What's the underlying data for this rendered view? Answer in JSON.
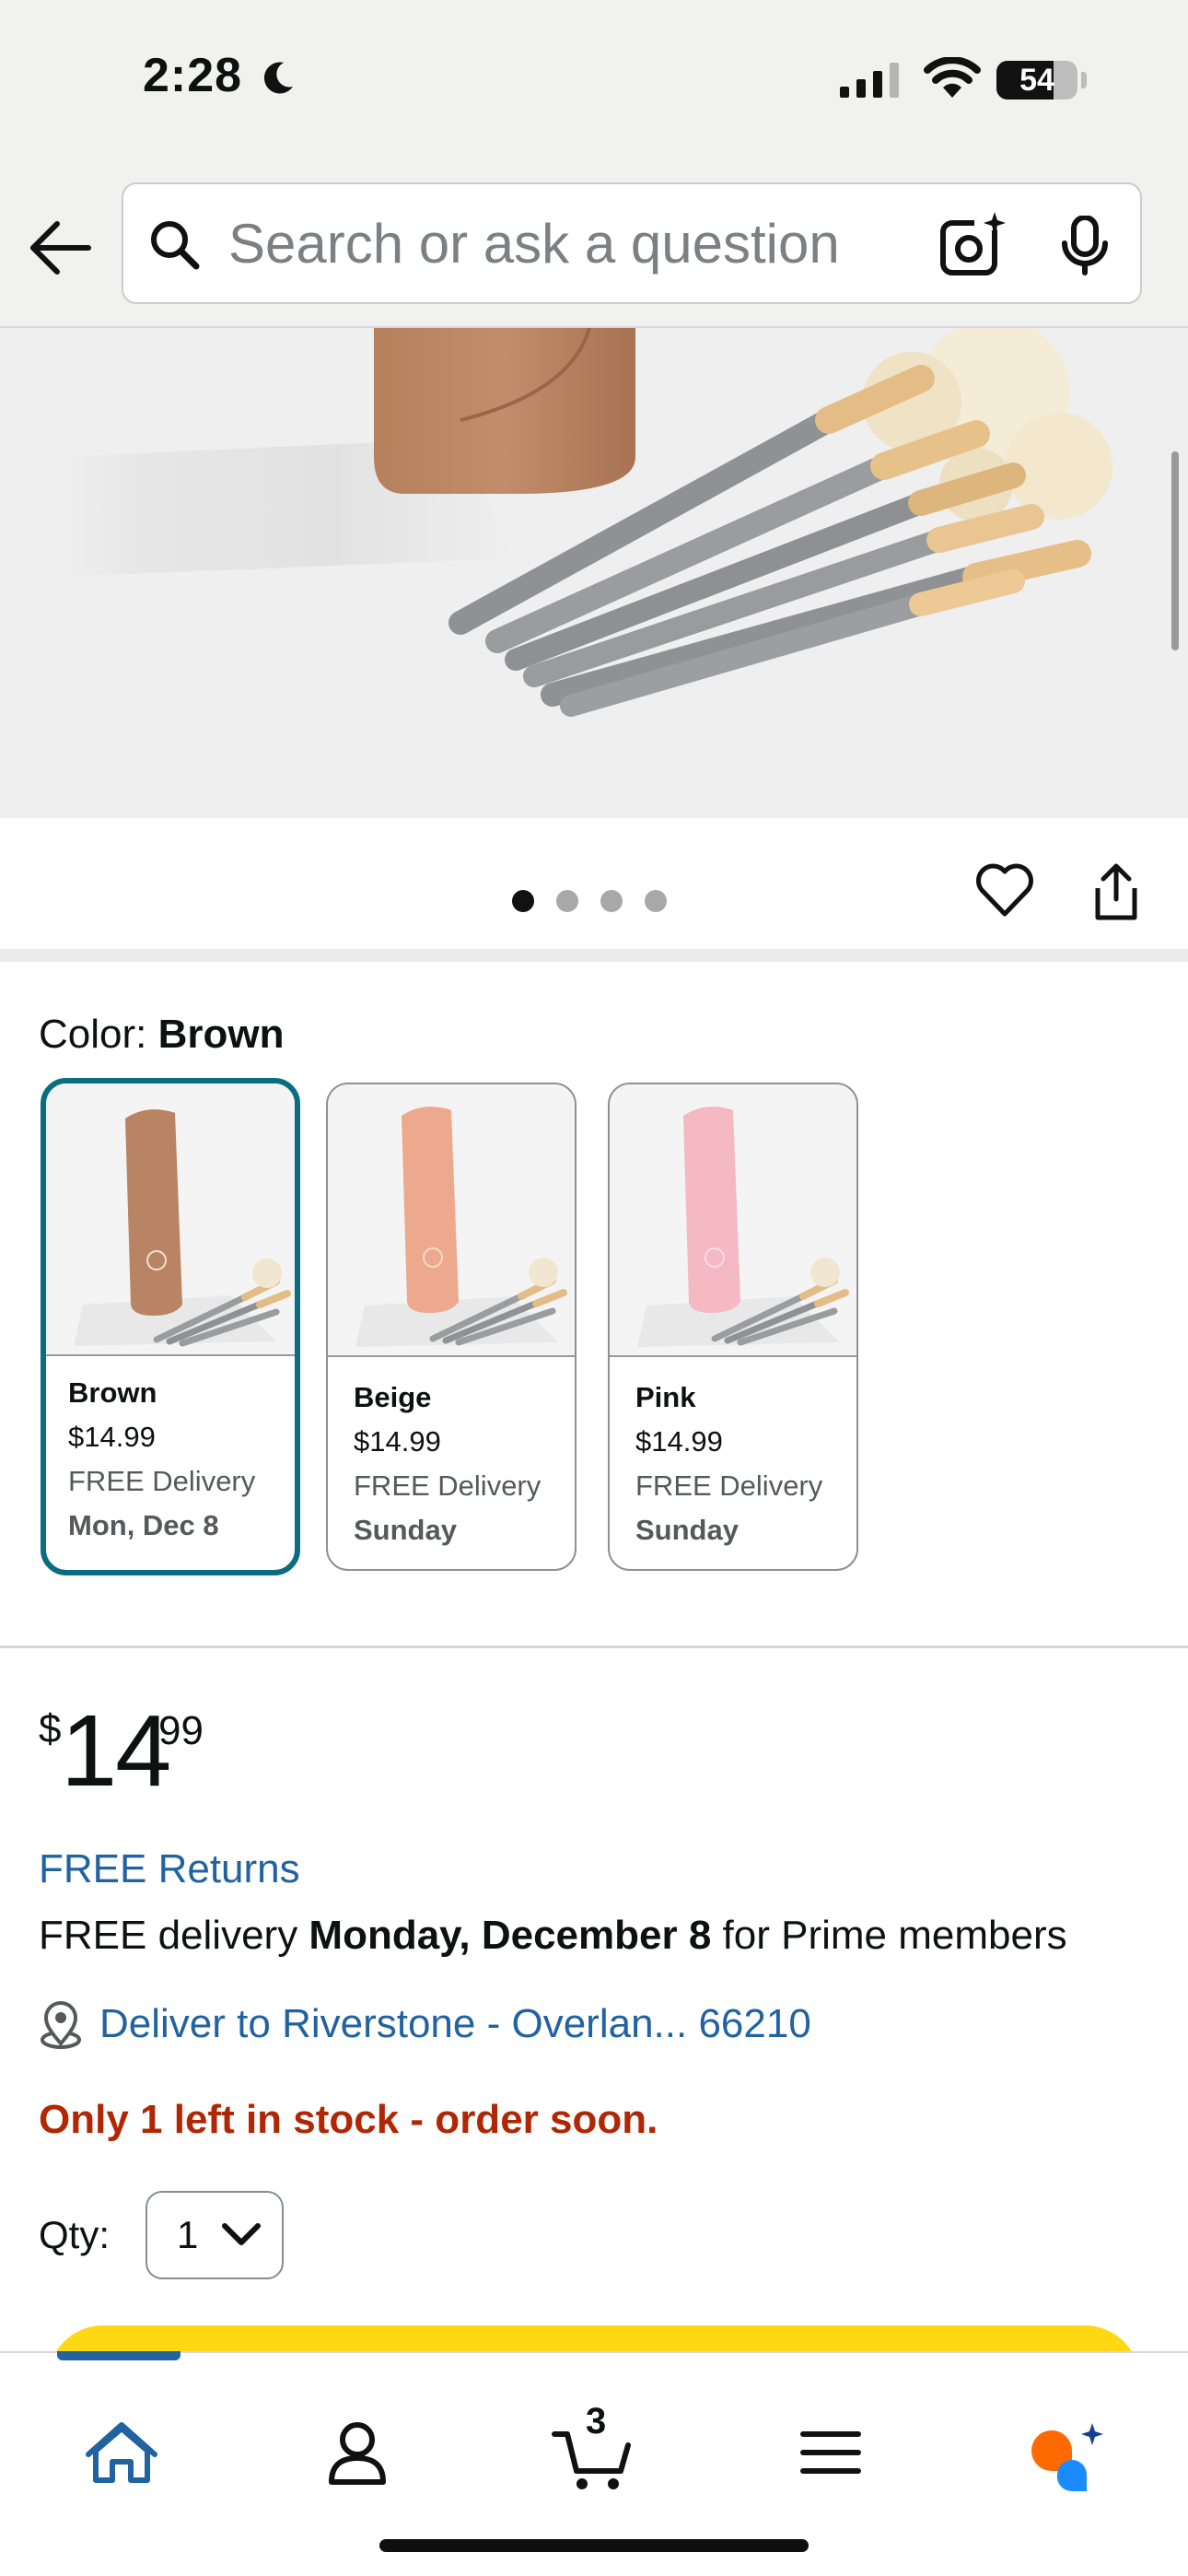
{
  "status_bar": {
    "time": "2:28",
    "battery": "54",
    "battery_level": 0.54
  },
  "search": {
    "placeholder": "Search or ask a question"
  },
  "gallery": {
    "image_count": 4,
    "active_index": 0
  },
  "color": {
    "label": "Color:",
    "selected": "Brown",
    "options": [
      {
        "name": "Brown",
        "price": "$14.99",
        "delivery": "FREE Delivery",
        "date": "Mon, Dec 8",
        "case_color": "#b98463"
      },
      {
        "name": "Beige",
        "price": "$14.99",
        "delivery": "FREE Delivery",
        "date": "Sunday",
        "case_color": "#eda98e"
      },
      {
        "name": "Pink",
        "price": "$14.99",
        "delivery": "FREE Delivery",
        "date": "Sunday",
        "case_color": "#f4b9c3"
      }
    ]
  },
  "price": {
    "currency": "$",
    "whole": "14",
    "fraction": "99"
  },
  "returns": "FREE Returns",
  "delivery": {
    "prefix": "FREE delivery",
    "date": "Monday, December 8",
    "suffix": "for Prime members"
  },
  "location": "Deliver to Riverstone - Overlan... 66210",
  "stock": "Only 1 left in stock - order soon.",
  "quantity": {
    "label": "Qty:",
    "value": "1"
  },
  "tabbar": {
    "cart_count": "3",
    "active_tab": "home"
  },
  "colors": {
    "link": "#2162a1",
    "selected_border": "#0a6d80",
    "stock_red": "#b12704",
    "buy_yellow": "#ffd814",
    "tab_active": "#2162a1"
  }
}
